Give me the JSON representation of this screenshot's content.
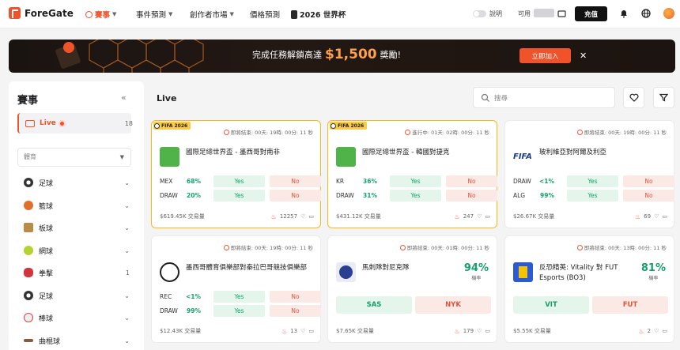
{
  "brand": {
    "name": "ForeGate",
    "accent": "#f0532a"
  },
  "nav": [
    {
      "label": "賽事",
      "active": true
    },
    {
      "label": "事件預測"
    },
    {
      "label": "創作者市場"
    },
    {
      "label": "價格預測"
    },
    {
      "label": "2026 世界杯"
    }
  ],
  "topbar": {
    "toggle_label": "說明",
    "balance_label": "可用",
    "deposit_label": "充值"
  },
  "banner": {
    "prefix": "完成任務解鎖高達",
    "amount": "$1,500",
    "suffix": "獎勵!",
    "cta": "立即加入"
  },
  "sidebar": {
    "title": "賽事",
    "live_label": "Live",
    "live_count": "18",
    "category_select": "體育",
    "sports": [
      {
        "label": "足球",
        "icon": "soccer-ball-icon",
        "color": "#3a3a3a"
      },
      {
        "label": "籃球",
        "icon": "basketball-icon",
        "color": "#e0702c"
      },
      {
        "label": "板球",
        "icon": "cricket-icon",
        "color": "#b98a4a"
      },
      {
        "label": "網球",
        "icon": "tennis-ball-icon",
        "color": "#b4d331"
      },
      {
        "label": "拳擊",
        "icon": "boxing-glove-icon",
        "color": "#d2343d",
        "count": "1"
      },
      {
        "label": "足球",
        "icon": "american-football-icon",
        "color": "#7a4a2a"
      },
      {
        "label": "棒球",
        "icon": "baseball-icon",
        "color": "#d8d8d8"
      },
      {
        "label": "曲棍球",
        "icon": "hockey-stick-icon",
        "color": "#8a5a3a"
      }
    ]
  },
  "main": {
    "title": "Live",
    "search_placeholder": "搜尋"
  },
  "cards": [
    {
      "badge": "FIFA 2026",
      "timer": "即將結束: 00天: 19時: 00分: 11 秒",
      "title": "國際足總世界盃 - 墨西哥對南非",
      "outcomes": [
        {
          "name": "MEX",
          "pct": "68%",
          "yes": "Yes",
          "no": "No"
        },
        {
          "name": "DRAW",
          "pct": "20%",
          "yes": "Yes",
          "no": "No"
        }
      ],
      "volume": "$619.45K 交易量",
      "comments": "12257"
    },
    {
      "badge": "FIFA 2026",
      "timer": "進行中: 01天: 02時: 00分: 11 秒",
      "title": "國際足總世界盃 - 韓國對捷克",
      "outcomes": [
        {
          "name": "KR",
          "pct": "36%",
          "yes": "Yes",
          "no": "No"
        },
        {
          "name": "DRAW",
          "pct": "31%",
          "yes": "Yes",
          "no": "No"
        }
      ],
      "volume": "$431.12K 交易量",
      "comments": "247"
    },
    {
      "timer": "即將結束: 00天: 19時: 00分: 11 秒",
      "title": "玻利維亞對阿爾及利亞",
      "logo_text": "FIFA",
      "outcomes": [
        {
          "name": "DRAW",
          "pct": "<1%",
          "yes": "Yes",
          "no": "No"
        },
        {
          "name": "ALG",
          "pct": "99%",
          "yes": "Yes",
          "no": "No"
        }
      ],
      "volume": "$26.67K 交易量",
      "comments": "69"
    },
    {
      "timer": "即將結束: 00天: 19時: 00分: 11 秒",
      "title": "墨西哥體育俱樂部對秦拉巴哥競技俱樂部",
      "outcomes": [
        {
          "name": "REC",
          "pct": "<1%",
          "yes": "Yes",
          "no": "No"
        },
        {
          "name": "DRAW",
          "pct": "99%",
          "yes": "Yes",
          "no": "No"
        }
      ],
      "volume": "$12.43K 交易量",
      "comments": "13"
    },
    {
      "timer": "即將結束: 00天: 01時: 00分: 11 秒",
      "title": "馬刺隊對尼克隊",
      "big_pct": "94%",
      "big_pct_label": "機率",
      "left_btn": "SAS",
      "right_btn": "NYK",
      "volume": "$7.65K 交易量",
      "comments": "179"
    },
    {
      "timer": "即將結束: 00天: 13時: 00分: 11 秒",
      "title": "反恐精英: Vitality 對 FUT Esports (BO3)",
      "big_pct": "81%",
      "big_pct_label": "機率",
      "left_btn": "VIT",
      "right_btn": "FUT",
      "volume": "$5.55K 交易量",
      "comments": "2"
    }
  ]
}
